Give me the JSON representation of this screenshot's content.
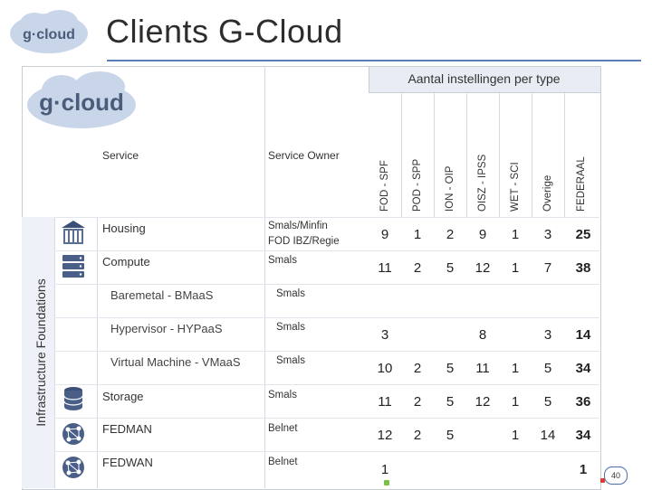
{
  "title": "Clients G-Cloud",
  "logo_text": "g·cloud",
  "table_header": "Aantal instellingen per type",
  "col_service": "Service",
  "col_owner": "Service Owner",
  "vertical_label": "Infrastructure Foundations",
  "types": [
    "FOD - SPF",
    "POD - SPP",
    "ION - OIP",
    "OISZ - IPSS",
    "WET - SCI",
    "Overige",
    "FEDERAAL"
  ],
  "rows": [
    {
      "service": "Housing",
      "owner1": "Smals/Minfin",
      "owner2": "FOD IBZ/Regie",
      "values": [
        "9",
        "1",
        "2",
        "9",
        "1",
        "3",
        "25"
      ]
    },
    {
      "service": "Compute",
      "owner1": "Smals",
      "owner2": "",
      "values": [
        "11",
        "2",
        "5",
        "12",
        "1",
        "7",
        "38"
      ]
    },
    {
      "service": "Baremetal - BMaaS",
      "owner1": "Smals",
      "owner2": "",
      "values": [
        "",
        "",
        "",
        "",
        "",
        "",
        ""
      ]
    },
    {
      "service": "Hypervisor - HYPaaS",
      "owner1": "Smals",
      "owner2": "",
      "values": [
        "3",
        "",
        "",
        "8",
        "",
        "3",
        "14"
      ]
    },
    {
      "service": "Virtual Machine - VMaaS",
      "owner1": "Smals",
      "owner2": "",
      "values": [
        "10",
        "2",
        "5",
        "11",
        "1",
        "5",
        "34"
      ]
    },
    {
      "service": "Storage",
      "owner1": "Smals",
      "owner2": "",
      "values": [
        "11",
        "2",
        "5",
        "12",
        "1",
        "5",
        "36"
      ]
    },
    {
      "service": "FEDMAN",
      "owner1": "Belnet",
      "owner2": "",
      "values": [
        "12",
        "2",
        "5",
        "",
        "1",
        "14",
        "34"
      ]
    },
    {
      "service": "FEDWAN",
      "owner1": "Belnet",
      "owner2": "",
      "values": [
        "1",
        "",
        "",
        "",
        "",
        "",
        "1"
      ]
    }
  ],
  "page_number": "40"
}
